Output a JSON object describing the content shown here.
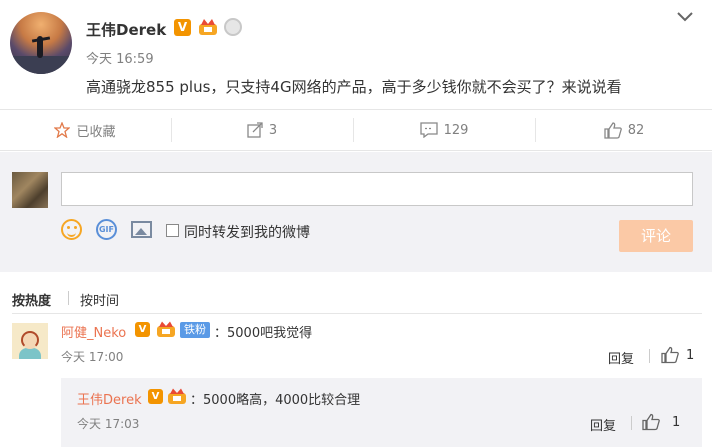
{
  "post": {
    "username": "王伟Derek",
    "verified_badge": "V",
    "timestamp": "今天 16:59",
    "text": "高通骁龙855 plus，只支持4G网络的产品，高于多少钱你就不会买了？来说说看"
  },
  "actions": {
    "favorite_label": "已收藏",
    "repost_count": "3",
    "comment_count": "129",
    "like_count": "82"
  },
  "comment_box": {
    "placeholder": "",
    "gif_label": "GIF",
    "repost_checkbox_label": "同时转发到我的微博",
    "submit_label": "评论"
  },
  "sort": {
    "hot_label": "按热度",
    "time_label": "按时间"
  },
  "comments": [
    {
      "user": "阿健_Neko",
      "verified_badge": "V",
      "fan_badge": "铁粉",
      "text": "：5000吧我觉得",
      "time": "今天 17:00",
      "reply_label": "回复",
      "likes": "1",
      "replies": [
        {
          "user": "王伟Derek",
          "verified_badge": "V",
          "text": "：5000略高，4000比较合理",
          "time": "今天 17:03",
          "reply_label": "回复",
          "likes": "1"
        }
      ]
    }
  ],
  "colors": {
    "accent_orange": "#eb7350",
    "submit_disabled": "#fbc9a6",
    "verified": "#f39400",
    "fan_badge": "#5a9ae6",
    "comment_bg": "#f2f2f5"
  }
}
